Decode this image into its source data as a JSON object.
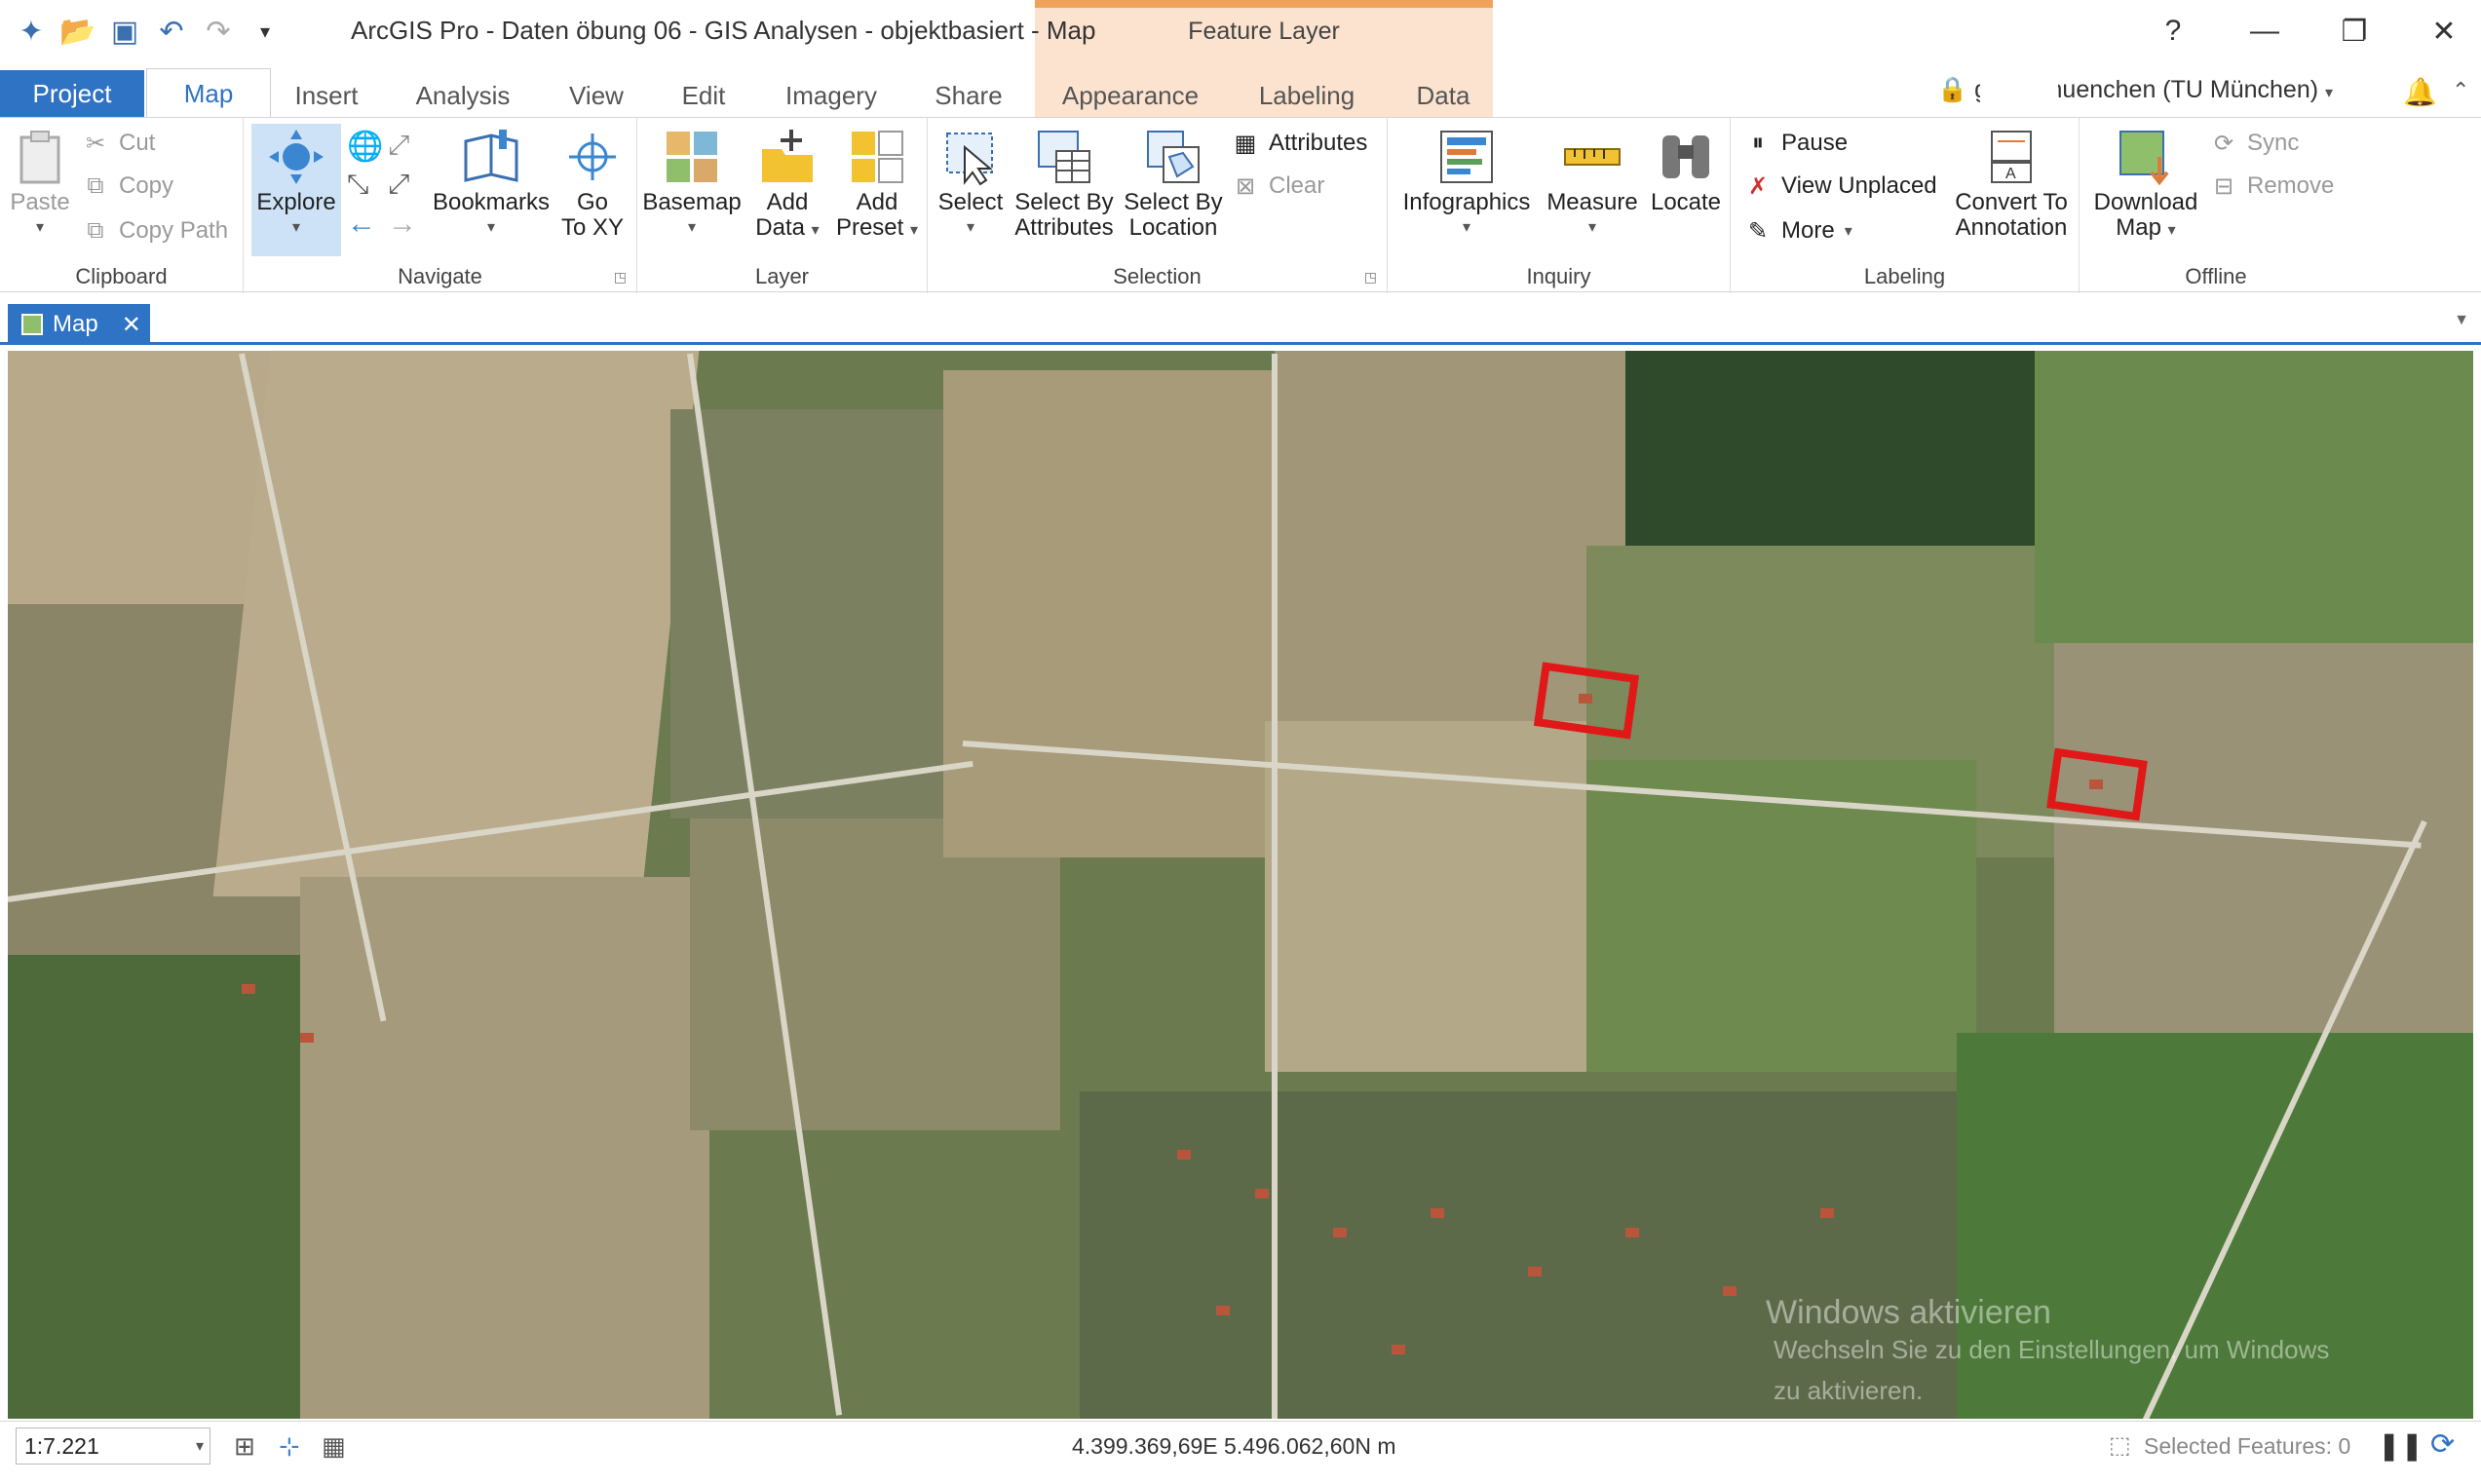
{
  "titlebar": {
    "title": "ArcGIS Pro - Daten öbung 06 - GIS Analysen - objektbasiert - Map",
    "context_title": "Feature Layer",
    "help": "?",
    "minimize": "—",
    "restore": "❐",
    "close": "✕"
  },
  "tabs": {
    "project": "Project",
    "map": "Map",
    "insert": "Insert",
    "analysis": "Analysis",
    "view": "View",
    "edit": "Edit",
    "imagery": "Imagery",
    "share": "Share",
    "appearance": "Appearance",
    "labeling": "Labeling",
    "data": "Data"
  },
  "account": {
    "name": "g           _tu_muenchen (TU München)"
  },
  "ribbon": {
    "clipboard": {
      "label": "Clipboard",
      "paste": "Paste",
      "cut": "Cut",
      "copy": "Copy",
      "copy_path": "Copy Path"
    },
    "navigate": {
      "label": "Navigate",
      "explore": "Explore",
      "bookmarks": "Bookmarks",
      "goto1": "Go",
      "goto2": "To XY"
    },
    "layer": {
      "label": "Layer",
      "basemap": "Basemap",
      "add_data1": "Add",
      "add_data2": "Data",
      "add_preset1": "Add",
      "add_preset2": "Preset"
    },
    "selection": {
      "label": "Selection",
      "select": "Select",
      "by_attr1": "Select By",
      "by_attr2": "Attributes",
      "by_loc1": "Select By",
      "by_loc2": "Location",
      "attributes": "Attributes",
      "clear": "Clear"
    },
    "inquiry": {
      "label": "Inquiry",
      "infographics": "Infographics",
      "measure": "Measure",
      "locate": "Locate"
    },
    "labeling": {
      "label": "Labeling",
      "pause": "Pause",
      "view_unplaced": "View Unplaced",
      "more": "More",
      "convert1": "Convert To",
      "convert2": "Annotation"
    },
    "offline": {
      "label": "Offline",
      "download1": "Download",
      "download2": "Map",
      "sync": "Sync",
      "remove": "Remove"
    }
  },
  "map_tab": {
    "label": "Map"
  },
  "watermark": {
    "line1": "Windows aktivieren",
    "line2": "Wechseln Sie zu den Einstellungen, um Windows",
    "line3": "zu aktivieren."
  },
  "status": {
    "scale": "1:7.221",
    "coordinates": "4.399.369,69E 5.496.062,60N m",
    "selected": "Selected Features: 0"
  }
}
